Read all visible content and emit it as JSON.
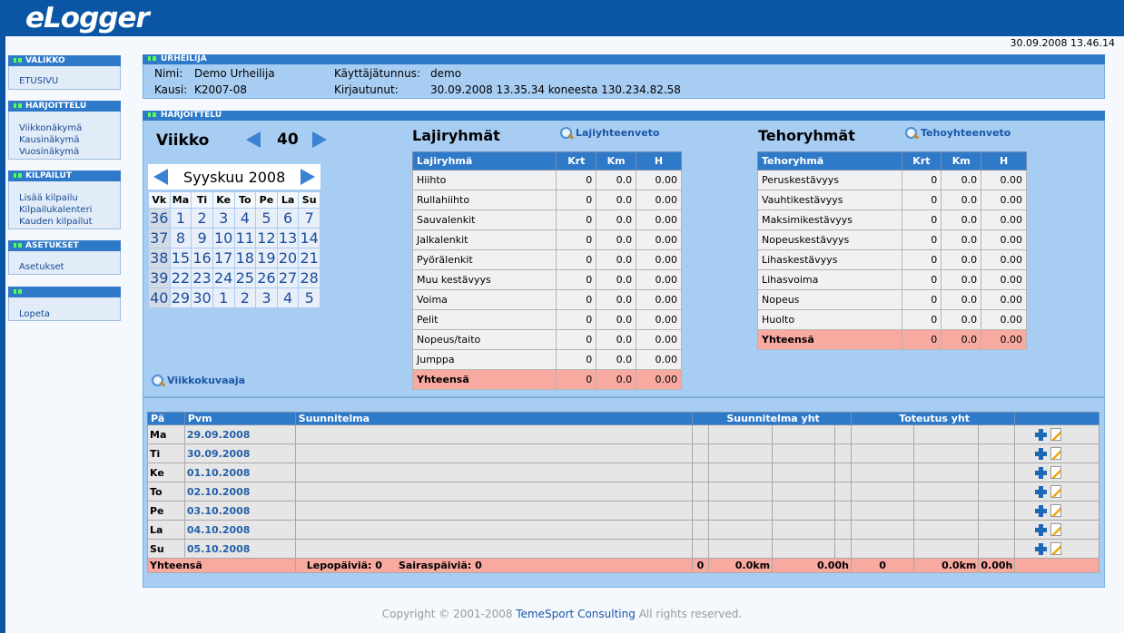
{
  "app": {
    "logo": "eLogger",
    "datetime": "30.09.2008 13.46.14"
  },
  "sidebar": {
    "sections": [
      {
        "title": "VALIKKO",
        "items": [
          "ETUSIVU"
        ]
      },
      {
        "title": "HARJOITTELU",
        "items": [
          "Viikkonäkymä",
          "Kausinäkymä",
          "Vuosinäkymä"
        ]
      },
      {
        "title": "KILPAILUT",
        "items": [
          "Lisää kilpailu",
          "Kilpailukalenteri",
          "Kauden kilpailut"
        ]
      },
      {
        "title": "ASETUKSET",
        "items": [
          "Asetukset"
        ]
      },
      {
        "title": "",
        "items": [
          "Lopeta"
        ]
      }
    ]
  },
  "athlete": {
    "panel_title": "URHEILIJA",
    "name_label": "Nimi:",
    "name": "Demo Urheilija",
    "season_label": "Kausi:",
    "season": "K2007-08",
    "username_label": "Käyttäjätunnus:",
    "username": "demo",
    "login_label": "Kirjautunut:",
    "login": "30.09.2008 13.35.34 koneesta 130.234.82.58"
  },
  "training": {
    "panel_title": "HARJOITTELU",
    "week_label": "Viikko",
    "week_number": "40",
    "week_chart_link": "Viikkokuvaaja"
  },
  "calendar": {
    "month": "Syyskuu 2008",
    "headers": [
      "Vk",
      "Ma",
      "Ti",
      "Ke",
      "To",
      "Pe",
      "La",
      "Su"
    ],
    "rows": [
      [
        "36",
        "1",
        "2",
        "3",
        "4",
        "5",
        "6",
        "7"
      ],
      [
        "37",
        "8",
        "9",
        "10",
        "11",
        "12",
        "13",
        "14"
      ],
      [
        "38",
        "15",
        "16",
        "17",
        "18",
        "19",
        "20",
        "21"
      ],
      [
        "39",
        "22",
        "23",
        "24",
        "25",
        "26",
        "27",
        "28"
      ],
      [
        "40",
        "29",
        "30",
        "1",
        "2",
        "3",
        "4",
        "5"
      ]
    ]
  },
  "sport_groups": {
    "title": "Lajiryhmät",
    "link": "Lajiyhteenveto",
    "headers": [
      "Lajiryhmä",
      "Krt",
      "Km",
      "H"
    ],
    "rows": [
      [
        "Hiihto",
        "0",
        "0.0",
        "0.00"
      ],
      [
        "Rullahiihto",
        "0",
        "0.0",
        "0.00"
      ],
      [
        "Sauvalenkit",
        "0",
        "0.0",
        "0.00"
      ],
      [
        "Jalkalenkit",
        "0",
        "0.0",
        "0.00"
      ],
      [
        "Pyörälenkit",
        "0",
        "0.0",
        "0.00"
      ],
      [
        "Muu kestävyys",
        "0",
        "0.0",
        "0.00"
      ],
      [
        "Voima",
        "0",
        "0.0",
        "0.00"
      ],
      [
        "Pelit",
        "0",
        "0.0",
        "0.00"
      ],
      [
        "Nopeus/taito",
        "0",
        "0.0",
        "0.00"
      ],
      [
        "Jumppa",
        "0",
        "0.0",
        "0.00"
      ]
    ],
    "total": [
      "Yhteensä",
      "0",
      "0.0",
      "0.00"
    ]
  },
  "intensity_groups": {
    "title": "Tehoryhmät",
    "link": "Tehoyhteenveto",
    "headers": [
      "Tehoryhmä",
      "Krt",
      "Km",
      "H"
    ],
    "rows": [
      [
        "Peruskestävyys",
        "0",
        "0.0",
        "0.00"
      ],
      [
        "Vauhtikestävyys",
        "0",
        "0.0",
        "0.00"
      ],
      [
        "Maksimikestävyys",
        "0",
        "0.0",
        "0.00"
      ],
      [
        "Nopeuskestävyys",
        "0",
        "0.0",
        "0.00"
      ],
      [
        "Lihaskestävyys",
        "0",
        "0.0",
        "0.00"
      ],
      [
        "Lihasvoima",
        "0",
        "0.0",
        "0.00"
      ],
      [
        "Nopeus",
        "0",
        "0.0",
        "0.00"
      ],
      [
        "Huolto",
        "0",
        "0.0",
        "0.00"
      ]
    ],
    "total": [
      "Yhteensä",
      "0",
      "0.0",
      "0.00"
    ]
  },
  "week_table": {
    "headers": {
      "day": "Pä",
      "date": "Pvm",
      "plan": "Suunnitelma",
      "plan_total": "Suunnitelma yht",
      "actual_total": "Toteutus yht"
    },
    "days": [
      {
        "day": "Ma",
        "date": "29.09.2008"
      },
      {
        "day": "Ti",
        "date": "30.09.2008"
      },
      {
        "day": "Ke",
        "date": "01.10.2008"
      },
      {
        "day": "To",
        "date": "02.10.2008"
      },
      {
        "day": "Pe",
        "date": "03.10.2008"
      },
      {
        "day": "La",
        "date": "04.10.2008"
      },
      {
        "day": "Su",
        "date": "05.10.2008"
      }
    ],
    "total": {
      "label": "Yhteensä",
      "rest_days": "Lepopäiviä: 0",
      "sick_days": "Sairaspäiviä: 0",
      "plan_count": "0",
      "plan_km": "0.0km",
      "plan_h": "0.00h",
      "actual_count": "0",
      "actual_km": "0.0km",
      "actual_h": "0.00h"
    }
  },
  "footer": {
    "prefix": "Copyright © 2001-2008",
    "company": "TemeSport Consulting",
    "suffix": "All rights reserved."
  }
}
